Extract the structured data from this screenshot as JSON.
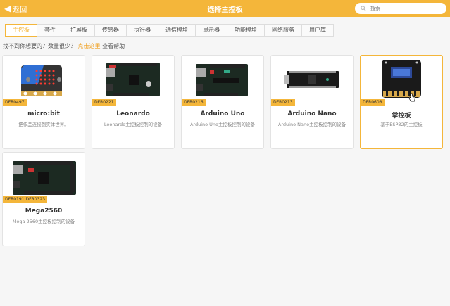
{
  "header": {
    "back_label": "返回",
    "title": "选择主控板",
    "search_placeholder": "搜索"
  },
  "tabs": [
    {
      "label": "主控板",
      "active": true
    },
    {
      "label": "套件"
    },
    {
      "label": "扩展板"
    },
    {
      "label": "传感器"
    },
    {
      "label": "执行器"
    },
    {
      "label": "通信模块"
    },
    {
      "label": "显示器"
    },
    {
      "label": "功能模块"
    },
    {
      "label": "网络服务"
    },
    {
      "label": "用户库"
    }
  ],
  "help": {
    "prefix": "找不到你想要的？数量很少？",
    "link": "点击这里",
    "suffix": "查看帮助"
  },
  "boards": [
    {
      "tag": "DFR0497",
      "name": "micro:bit",
      "desc": "把作品连接到实体世界。",
      "icon": "microbit-board-image"
    },
    {
      "tag": "DFR0221",
      "name": "Leonardo",
      "desc": "Leonardo主控板控制的设备",
      "icon": "leonardo-board-image"
    },
    {
      "tag": "DFR0216",
      "name": "Arduino Uno",
      "desc": "Arduino Uno主控板控制的设备",
      "icon": "arduino-uno-board-image"
    },
    {
      "tag": "DFR0213",
      "name": "Arduino Nano",
      "desc": "Arduino Nano主控板控制的设备",
      "icon": "arduino-nano-board-image"
    },
    {
      "tag": "DFR0608",
      "name": "掌控板",
      "desc": "基于ESP32的主控板",
      "icon": "handpy-board-image",
      "selected": true
    },
    {
      "tag": "DFR0191|DFR0323",
      "name": "Mega2560",
      "desc": "Mega 2560主控板控制的设备",
      "icon": "mega2560-board-image"
    }
  ],
  "colors": {
    "accent": "#f4b63a",
    "link": "#f0a020",
    "background": "#f6f6f6"
  }
}
